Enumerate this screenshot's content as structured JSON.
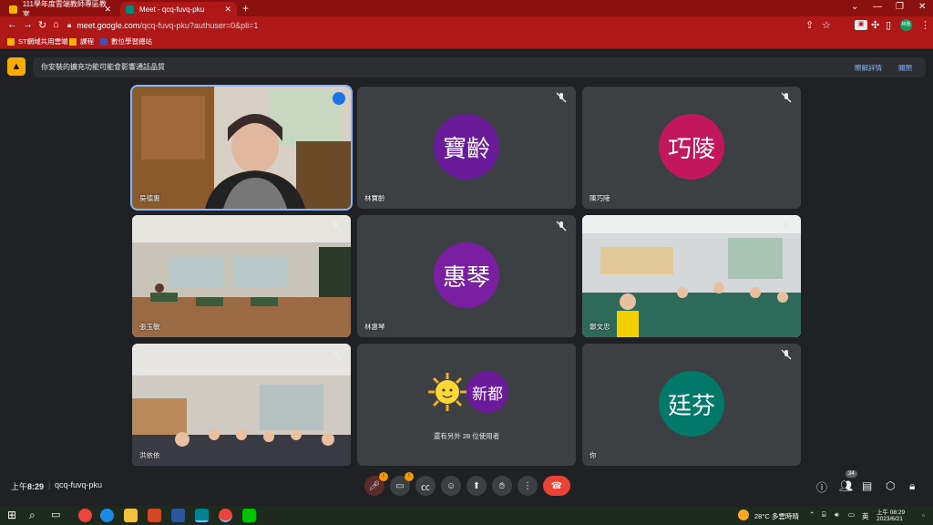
{
  "browser": {
    "tabs": [
      {
        "title": "111學年度雲端教師專區教室",
        "active": false
      },
      {
        "title": "Meet - qcq-fuvq-pku",
        "active": true
      }
    ],
    "url_host": "meet.google.com",
    "url_path": "/qcq-fuvq-pku?authuser=0&pli=1",
    "bookmarks": [
      "ST網域共用雲端",
      "課程",
      "數位學習總站"
    ],
    "profile_label": "林惠"
  },
  "banner": {
    "text": "你安裝的擴充功能可能會影響通話品質",
    "details_link": "瞭解詳情",
    "close_link": "關閉"
  },
  "tiles": [
    {
      "name": "吳德惠",
      "type": "video",
      "speaking": true
    },
    {
      "name": "林寶齡",
      "type": "avatar",
      "initials": "寶齡",
      "color": "#6a1b9a"
    },
    {
      "name": "陳巧陵",
      "type": "avatar",
      "initials": "巧陵",
      "color": "#c2185b"
    },
    {
      "name": "張玉敏",
      "type": "video"
    },
    {
      "name": "林惠琴",
      "type": "avatar",
      "initials": "惠琴",
      "color": "#7b1fa2"
    },
    {
      "name": "鄭文忠",
      "type": "video"
    },
    {
      "name": "洪依依",
      "type": "video"
    },
    {
      "name": "",
      "type": "others",
      "initials": "新都",
      "text": "還有另外 28 位使用者"
    },
    {
      "name": "你",
      "type": "avatar",
      "initials": "廷芬",
      "color": "#00796b"
    }
  ],
  "bottom": {
    "time_prefix": "上午",
    "time": "8:29",
    "meeting_code": "qcq-fuvq-pku",
    "participant_count": "34",
    "badge_mic": "!",
    "badge_cam": "!"
  },
  "taskbar": {
    "weather": "28°C  多雲時晴",
    "ime": "英",
    "clock_time": "上午 08:29",
    "clock_date": "2023/6/21"
  }
}
